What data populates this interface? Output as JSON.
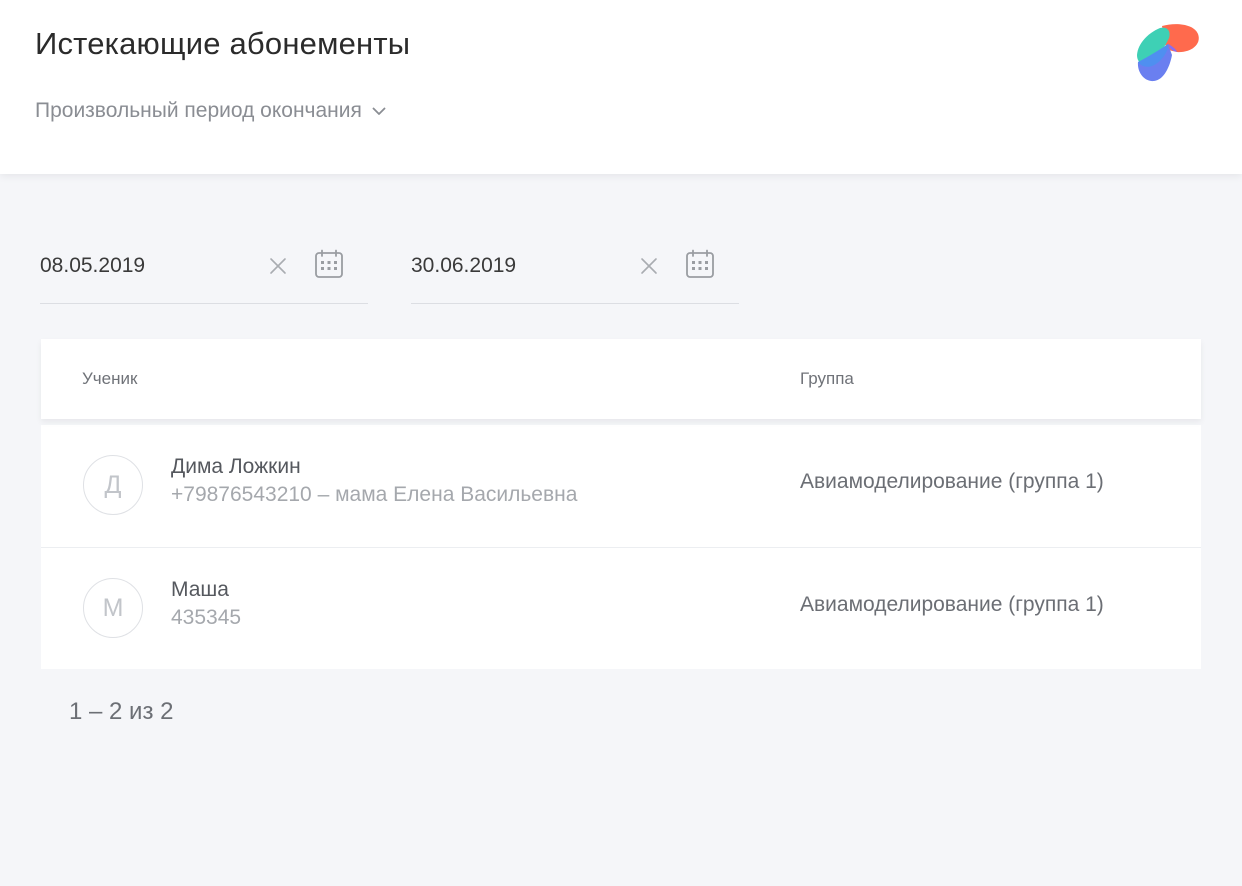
{
  "header": {
    "title": "Истекающие абонементы",
    "period_label": "Произвольный период окончания"
  },
  "filters": {
    "date_from": "08.05.2019",
    "date_to": "30.06.2019"
  },
  "table": {
    "columns": {
      "student": "Ученик",
      "group": "Группа"
    },
    "rows": [
      {
        "initial": "Д",
        "name": "Дима Ложкин",
        "contact": "+79876543210 – мама Елена Васильевна",
        "group": "Авиамоделирование (группа 1)"
      },
      {
        "initial": "М",
        "name": "Маша",
        "contact": "435345",
        "group": "Авиамоделирование (группа 1)"
      }
    ]
  },
  "pagination": {
    "label": "1 – 2 из 2"
  },
  "icons": {
    "chevron": "chevron-down-icon",
    "clear": "close-icon",
    "calendar": "calendar-icon",
    "logo": "app-logo-icon"
  },
  "colors": {
    "logo_orange": "#ff6a4d",
    "logo_teal": "#3ed0b5",
    "logo_blue": "#4f8ff0",
    "logo_purple": "#8a6cf0"
  }
}
